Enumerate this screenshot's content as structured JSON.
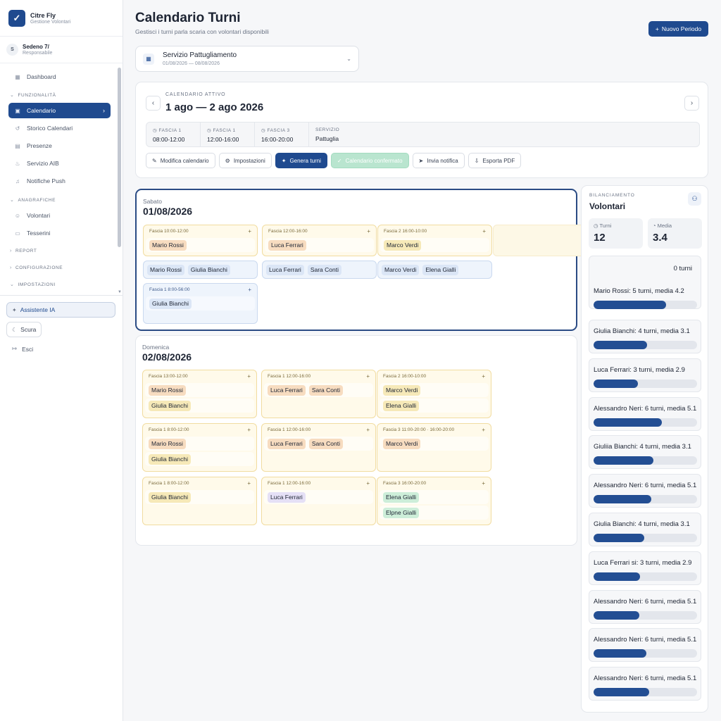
{
  "brand": {
    "name": "Citre Fly",
    "subtitle": "Gestione Volontari"
  },
  "org": {
    "badge": "S",
    "name": "Sedeno 7/",
    "role": "Responsabile"
  },
  "sidebar": {
    "items": [
      {
        "label": "Dashboard",
        "icon": "grid-icon"
      },
      {
        "label": "FUNZIONALITÀ",
        "section": true
      },
      {
        "label": "Calendario",
        "icon": "calendar-icon",
        "active": true
      },
      {
        "label": "Storico Calendari",
        "icon": "history-icon"
      },
      {
        "label": "Presenze",
        "icon": "clipboard-icon"
      },
      {
        "label": "Servizio AIB",
        "icon": "flame-icon"
      },
      {
        "label": "Notifiche Push",
        "icon": "bell-icon"
      },
      {
        "label": "ANAGRAFICHE",
        "section": true
      },
      {
        "label": "Volontari",
        "icon": "user-icon"
      },
      {
        "label": "Tesserini",
        "icon": "id-card-icon"
      },
      {
        "label": "REPORT",
        "section": true
      },
      {
        "label": "CONFIGURAZIONE",
        "section": true
      },
      {
        "label": "IMPOSTAZIONI",
        "section": true
      }
    ],
    "assistant": "Assistente IA",
    "theme": "Scura",
    "logout": "Esci"
  },
  "header": {
    "title": "Calendario Turni",
    "subtitle": "Gestisci i turni parla scaria con volontari disponibili",
    "new_button": "Nuovo Periodo"
  },
  "service": {
    "name": "Servizio Pattugliamento",
    "dates": "01/08/2026 — 08/08/2026"
  },
  "active_calendar": {
    "label": "CALENDARIO ATTIVO",
    "range": "1 ago — 2 ago 2026",
    "shifts": [
      {
        "label": "FASCIA 1",
        "value": "08:00-12:00"
      },
      {
        "label": "FASCIA 1",
        "value": "12:00-16:00"
      },
      {
        "label": "FASCIA 3",
        "value": "16:00-20:00"
      },
      {
        "label": "SERVIZIO",
        "value": "Pattuglia"
      }
    ],
    "actions": {
      "edit": "Modifica calendario",
      "settings": "Impostazioni",
      "generate": "Genera turni",
      "confirmed": "Calendario confermato",
      "notify": "Invia notifica",
      "export": "Esporta PDF"
    }
  },
  "days": {
    "saturday": {
      "name": "Sabato",
      "date": "01/08/2026",
      "slot1_head": "Fascia 10:00-12:00",
      "slot1_name": "Mario Rossi",
      "slot2_head": "Fascia 12:00-16:00",
      "slot2_name": "Luca Ferrari",
      "slot3_head": "Fascia 2 16:00-10:00",
      "slot3_name": "Marco Verdi",
      "pair1": [
        "Mario Rossi",
        "Giulia Bianchi"
      ],
      "pair2": [
        "Luca Ferrari",
        "Sara Conti"
      ],
      "pair3": [
        "Marco Verdi",
        "Elena Gialli"
      ],
      "slot4_head": "Fascia 1 8:00-56:00",
      "slot4_name": "Giulia Bianchi"
    },
    "sunday": {
      "name": "Domenica",
      "date": "02/08/2026",
      "r1s1_head": "Fascia 13:00-12:00",
      "r1s1_a": "Mario Rossi",
      "r1s1_b": "Giulia Bianchi",
      "r1s2_head": "Fascia 1 12:00-16:00",
      "r1s2_a": "Luca Ferrari",
      "r1s2_b": "Sara Conti",
      "r1s3_head": "Fascia 2 16:00-10:00",
      "r1s3_a": "Marco Verdi",
      "r1s3_b": "Elena Gialli",
      "r2s1_head": "Fascia 1 8:00-12:00",
      "r2s1_a": "Mario Rossi",
      "r2s1_b": "Giulia Bianchi",
      "r2s2_head": "Fascia 1 12:00-16:00",
      "r2s2_a": "Luca Ferrari",
      "r2s2_b": "Sara Conti",
      "r2s3_head": "Fascia 3 11:00-20:00 · 16:00-20:00",
      "r2s3_a": "Marco Verdi",
      "r3s1_head": "Fascia 1 8:00-12:00",
      "r3s1_a": "Giulia Bianchi",
      "r3s2_head": "Fascia 1 12:00-16:00",
      "r3s2_a": "Luca Ferrari",
      "r3s3_head": "Fascia 3 16:00-20:00",
      "r3s3_a": "Elena Gialli",
      "r3s3_b": "Elpne Gialli"
    }
  },
  "balance": {
    "label": "BILANCIAMENTO",
    "title": "Volontari",
    "turni_label": "Turni",
    "turni_value": "12",
    "media_label": "Media",
    "media_value": "3.4",
    "zero_label": "0 turni",
    "volunteers": [
      {
        "text": "Mario Rossi: 5 turni, media 4.2",
        "fill": 0.7
      },
      {
        "text": "Giulia Bianchi: 4 turni, media 3.1",
        "fill": 0.52
      },
      {
        "text": "Luca Ferrari: 3 turni, media 2.9",
        "fill": 0.43
      },
      {
        "text": "Alessandro Neri: 6 turni, media 5.1",
        "fill": 0.66
      },
      {
        "text": "Giuliia Bianchi: 4 turni, media 3.1",
        "fill": 0.58
      },
      {
        "text": "Alessandro Neri: 6 turni, media 5.1",
        "fill": 0.56
      },
      {
        "text": "Giulia Bianchi: 4 turni, media 3.1",
        "fill": 0.49
      },
      {
        "text": "Luca Ferrari si: 3 turni, media 2.9",
        "fill": 0.45
      },
      {
        "text": "Alessandro Neri: 6 turni, media 5.1",
        "fill": 0.44
      },
      {
        "text": "Alessandro Neri: 6 turni, media 5.1",
        "fill": 0.51
      },
      {
        "text": "Alessandro Neri: 6 turni, media 5.1",
        "fill": 0.54
      }
    ]
  },
  "colors": {
    "primary": "#1f4a8f",
    "confirmed": "#b9e5cf",
    "slot_yellow": "#fffaea",
    "slot_blue": "#eef4fc"
  }
}
